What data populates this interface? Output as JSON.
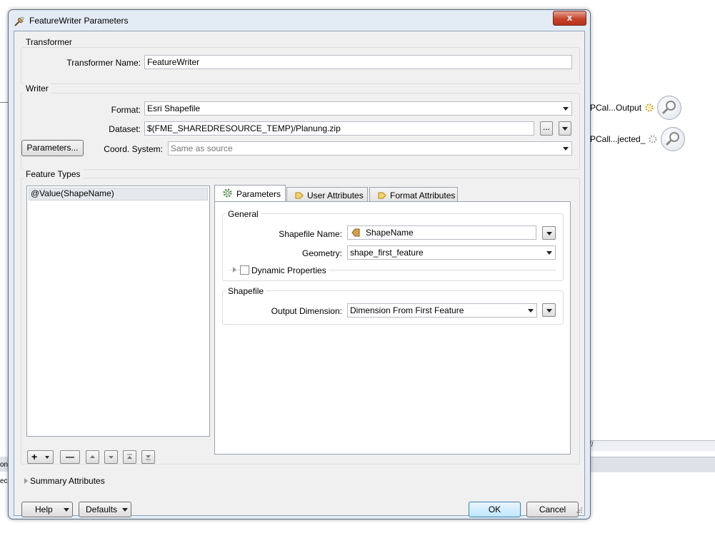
{
  "window": {
    "title": "FeatureWriter Parameters",
    "close_label": "x"
  },
  "background": {
    "node1_label": "PCal...Output",
    "node2_label": "PCall...jected_",
    "strip_text_left1": "on",
    "strip_text_left2": "ec",
    "strip_text_right": "//"
  },
  "transformer": {
    "group_title": "Transformer",
    "name_label": "Transformer Name:",
    "name_value": "FeatureWriter"
  },
  "writer": {
    "group_title": "Writer",
    "format_label": "Format:",
    "format_value": "Esri Shapefile",
    "dataset_label": "Dataset:",
    "dataset_value": "$(FME_SHAREDRESOURCE_TEMP)/Planung.zip",
    "browse_label": "...",
    "parameters_button": "Parameters...",
    "coord_label": "Coord. System:",
    "coord_value": "Same as source"
  },
  "feature_types": {
    "group_title": "Feature Types",
    "items": [
      "@Value(ShapeName)"
    ],
    "add_label": "+",
    "remove_label": "—"
  },
  "tabs": [
    "Parameters",
    "User Attributes",
    "Format Attributes"
  ],
  "general": {
    "title": "General",
    "shapefile_name_label": "Shapefile Name:",
    "shapefile_name_value": "ShapeName",
    "geometry_label": "Geometry:",
    "geometry_value": "shape_first_feature",
    "dynamic_label": "Dynamic Properties"
  },
  "shapefile": {
    "title": "Shapefile",
    "output_dimension_label": "Output Dimension:",
    "output_dimension_value": "Dimension From First Feature"
  },
  "summary_label": "Summary Attributes",
  "footer": {
    "help": "Help",
    "defaults": "Defaults",
    "ok": "OK",
    "cancel": "Cancel"
  }
}
